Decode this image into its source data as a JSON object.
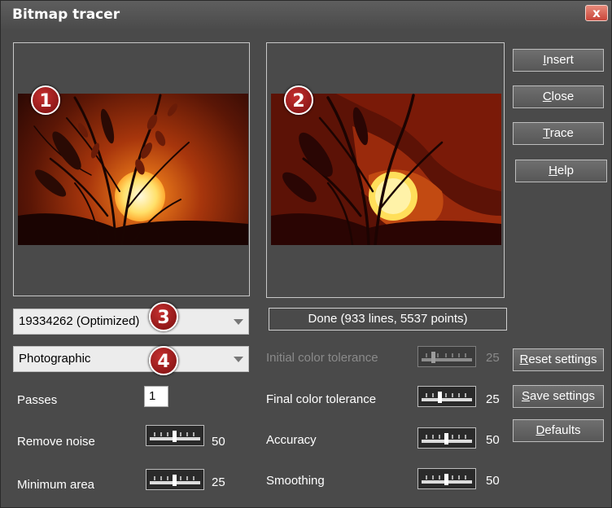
{
  "window": {
    "title": "Bitmap tracer",
    "close_label": "x"
  },
  "badges": {
    "original": "1",
    "traced": "2",
    "palette": "3",
    "mode": "4"
  },
  "buttons": {
    "insert": {
      "accel": "I",
      "rest": "nsert"
    },
    "close": {
      "accel": "C",
      "rest": "lose"
    },
    "trace": {
      "accel": "T",
      "rest": "race"
    },
    "help": {
      "accel": "H",
      "rest": "elp"
    },
    "reset": {
      "accel": "R",
      "rest": "eset settings"
    },
    "save": {
      "accel": "S",
      "rest": "ave settings"
    },
    "defaults": {
      "accel": "D",
      "rest": "efaults"
    }
  },
  "palette_select": {
    "value": "19334262 (Optimized)"
  },
  "mode_select": {
    "value": "Photographic"
  },
  "status": "Done (933 lines, 5537 points)",
  "settings": {
    "passes": {
      "label": "Passes",
      "value": "1"
    },
    "remove_noise": {
      "label": "Remove noise",
      "value": "50"
    },
    "minimum_area": {
      "label": "Minimum area",
      "value": "25"
    },
    "initial_color_tolerance": {
      "label": "Initial color tolerance",
      "value": "25",
      "enabled": false
    },
    "final_color_tolerance": {
      "label": "Final color tolerance",
      "value": "25"
    },
    "accuracy": {
      "label": "Accuracy",
      "value": "50"
    },
    "smoothing": {
      "label": "Smoothing",
      "value": "50"
    }
  },
  "colors": {
    "window_bg": "#4a4a4a",
    "close_button": "#c9463a",
    "badge": "#9b1a1a",
    "sun": "#ffd24a"
  },
  "icons": {
    "close": "close-icon",
    "dropdown": "chevron-down-icon",
    "slider": "slider-icon"
  }
}
